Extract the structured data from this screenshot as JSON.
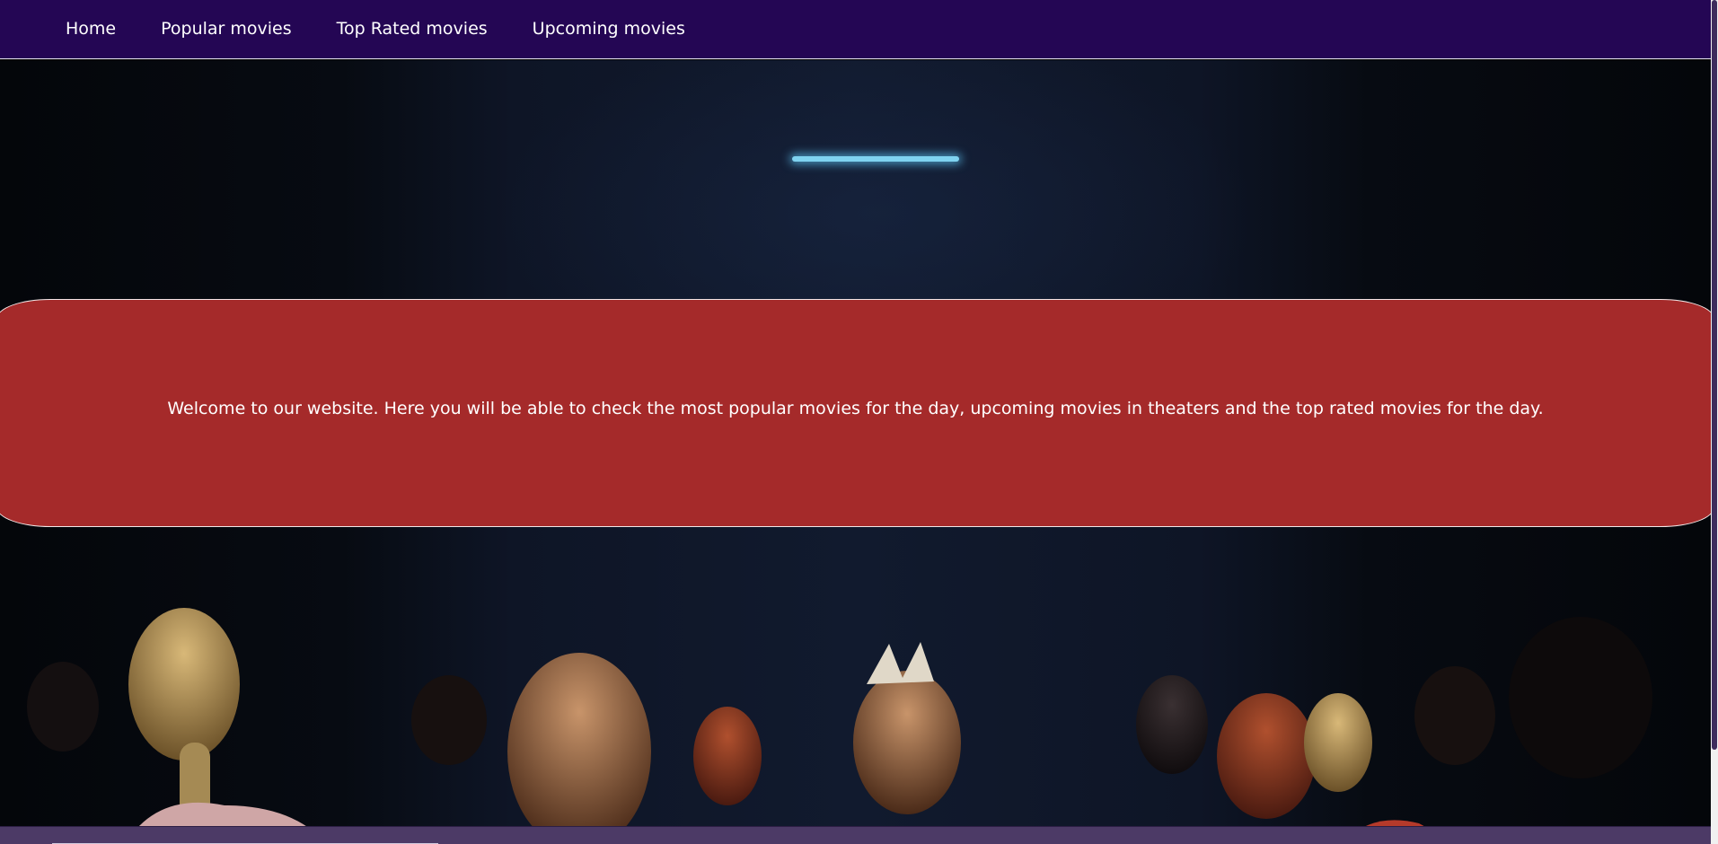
{
  "nav": {
    "items": [
      {
        "label": "Home"
      },
      {
        "label": "Popular movies"
      },
      {
        "label": "Top Rated movies"
      },
      {
        "label": "Upcoming movies"
      }
    ]
  },
  "banner": {
    "text": "Welcome to our website. Here you will be able to check the most popular movies for the day, upcoming movies in theaters and the top rated movies for the day."
  },
  "hero": {
    "image": "cinema-audience-photo"
  },
  "colors": {
    "nav_bg": "#240654",
    "banner_bg": "#a52a2a",
    "text": "#ffffff"
  }
}
